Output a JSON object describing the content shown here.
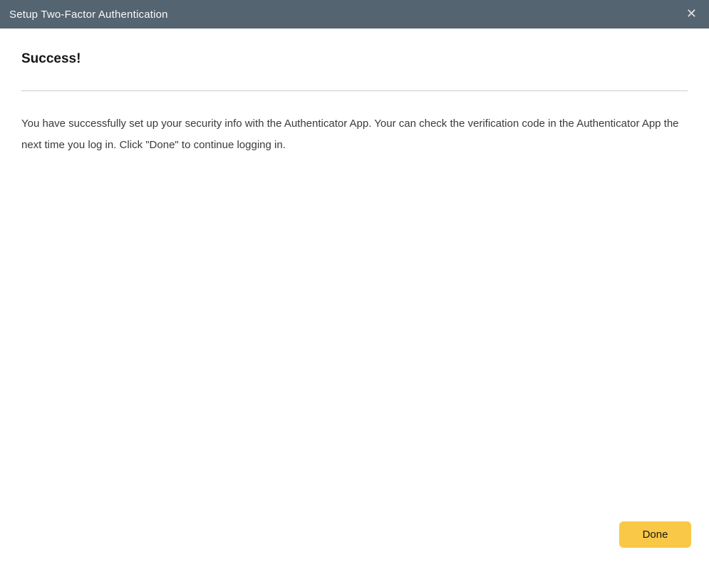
{
  "dialog": {
    "title": "Setup Two-Factor Authentication",
    "close_icon": "✕"
  },
  "content": {
    "heading": "Success!",
    "body": "You have successfully set up your security info with the Authenticator App. Your can check the verification code in the Authenticator App the next time you log in. Click \"Done\" to continue logging in."
  },
  "footer": {
    "done_label": "Done"
  },
  "colors": {
    "header_bg": "#546470",
    "header_text": "#fafafa",
    "button_bg": "#f9c846",
    "button_text": "#171717",
    "divider": "#cccccc",
    "body_text": "#3a3a3a"
  }
}
